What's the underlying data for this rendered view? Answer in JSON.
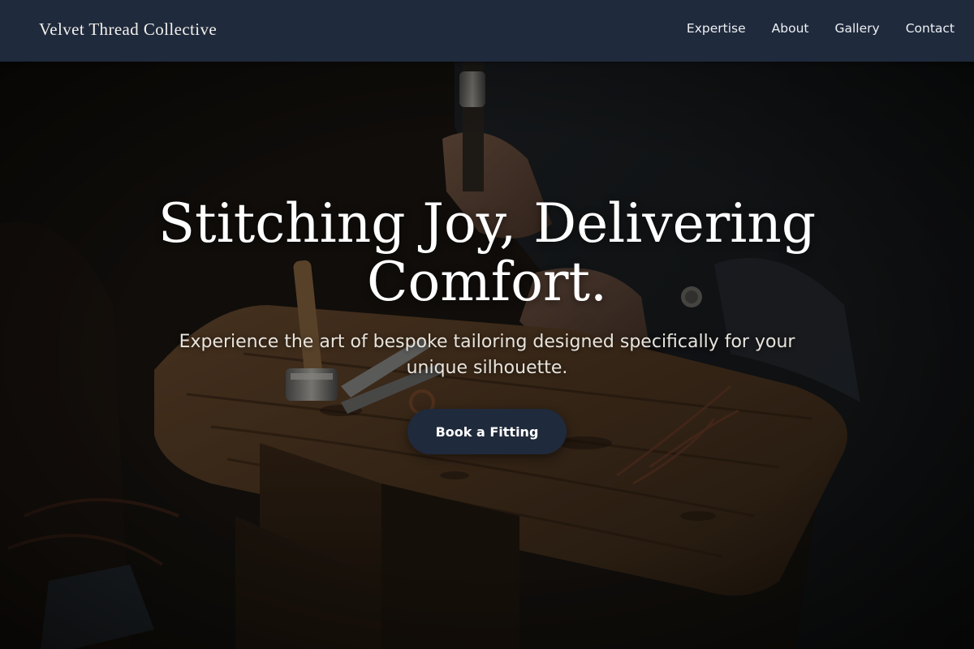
{
  "header": {
    "brand": "Velvet Thread Collective",
    "nav": [
      {
        "label": "Expertise"
      },
      {
        "label": "About"
      },
      {
        "label": "Gallery"
      },
      {
        "label": "Contact"
      }
    ]
  },
  "hero": {
    "title": "Stitching Joy, Delivering Comfort.",
    "subtitle": "Experience the art of bespoke tailoring designed specifically for your unique silhouette.",
    "cta_label": "Book a Fitting",
    "background_image": "workshop-craftsman-tools-icon"
  },
  "colors": {
    "header_bg": "#1f2a3c",
    "button_bg": "#1f2a3c",
    "text_light": "#ffffff"
  }
}
